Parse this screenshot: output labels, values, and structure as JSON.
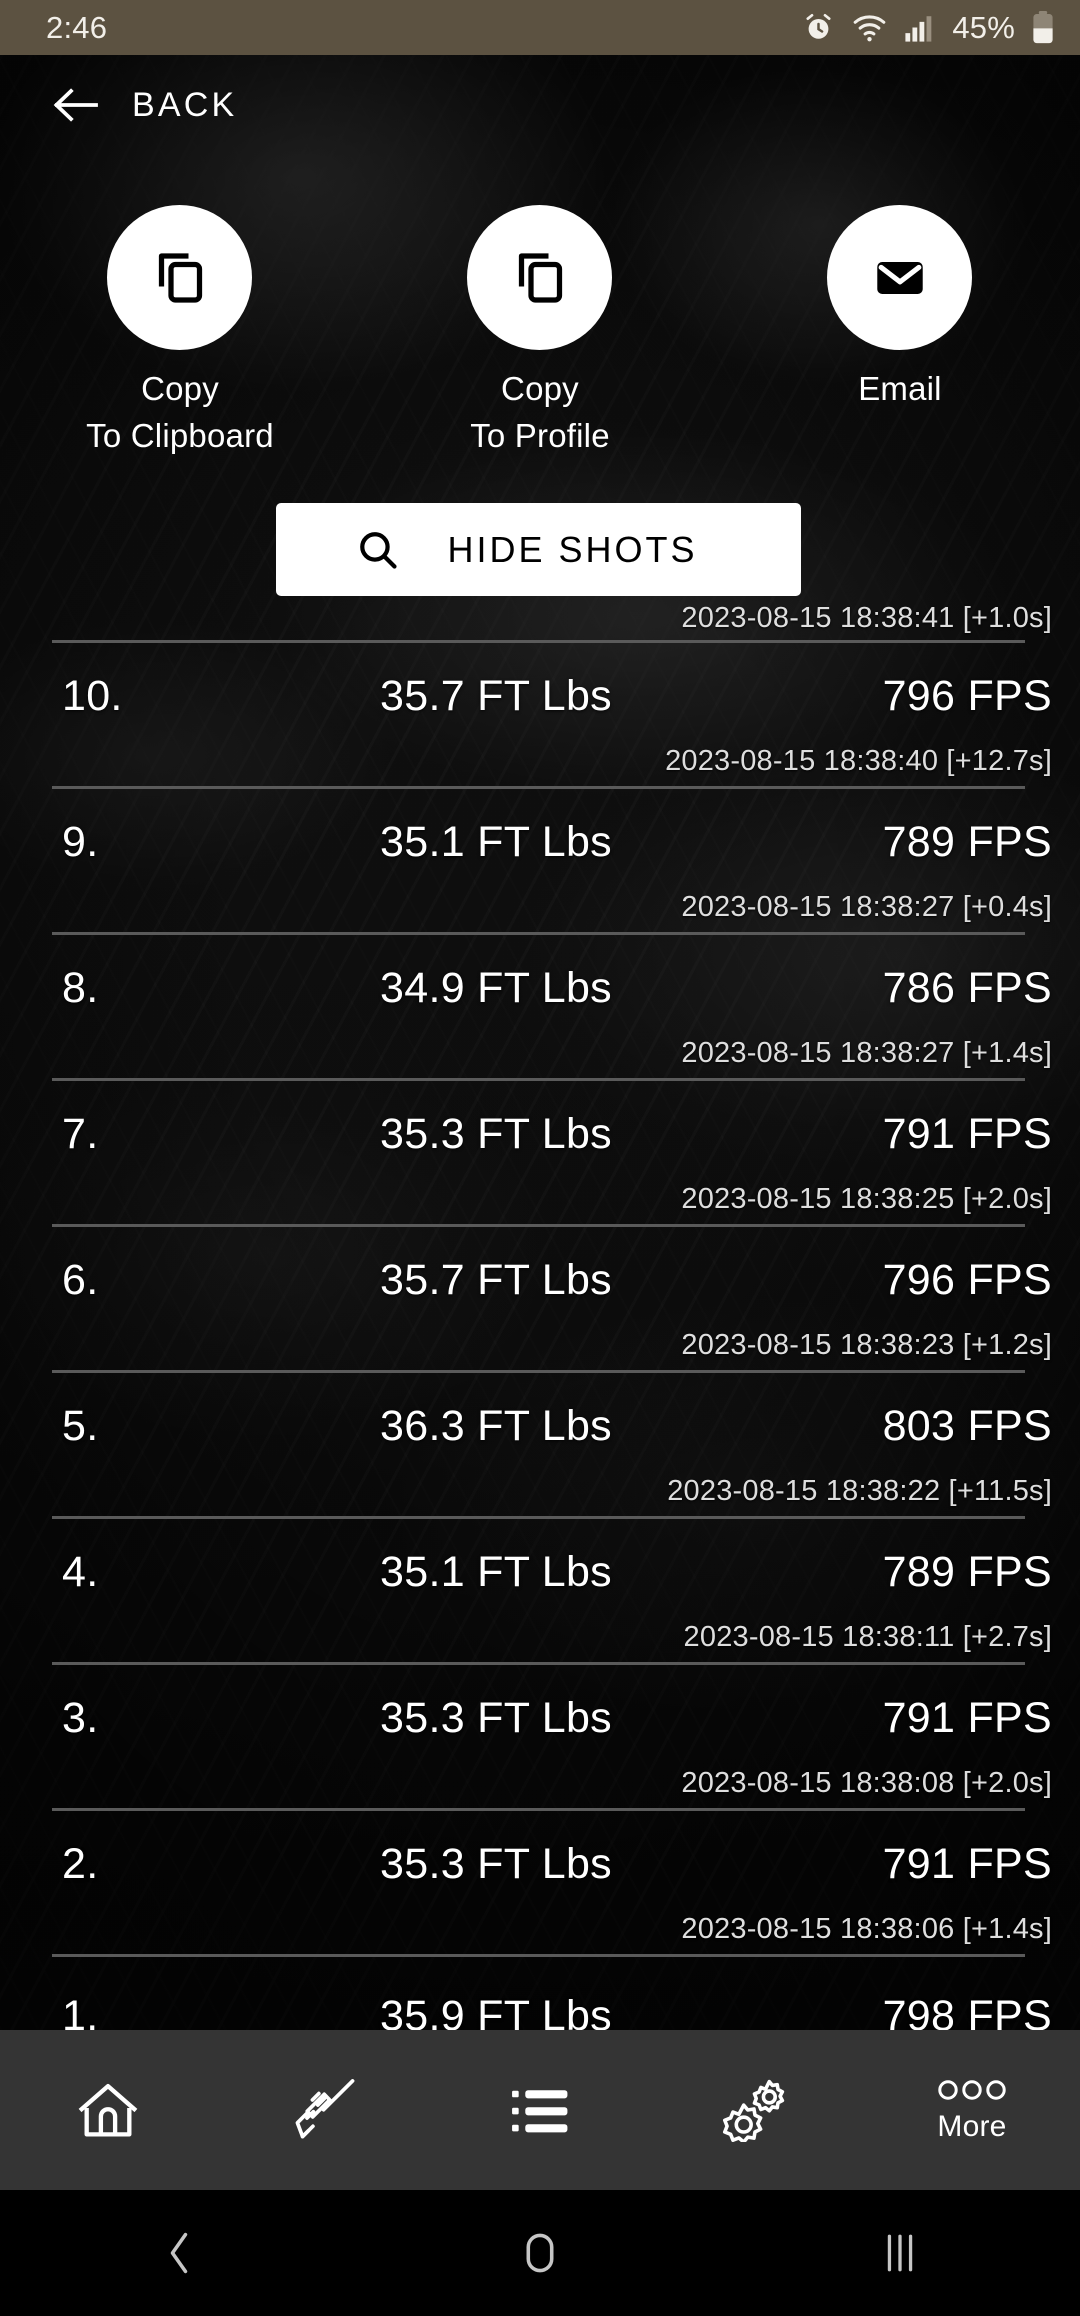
{
  "status_bar": {
    "time": "2:46",
    "battery_percent": "45%",
    "icons": [
      "alarm-clock-icon",
      "wifi-icon",
      "cellular-signal-icon",
      "battery-icon"
    ],
    "background_color": "#5c5241"
  },
  "header": {
    "back_label": "BACK",
    "back_icon": "arrow-left-icon"
  },
  "actions": [
    {
      "label": "Copy\nTo Clipboard",
      "icon": "copy-icon",
      "name": "copy-to-clipboard"
    },
    {
      "label": "Copy\nTo Profile",
      "icon": "copy-icon",
      "name": "copy-to-profile"
    },
    {
      "label": "Email",
      "icon": "envelope-icon",
      "name": "email"
    }
  ],
  "toolbar": {
    "hide_shots_label": "HIDE SHOTS",
    "hide_shots_icon": "search-icon"
  },
  "shot_list": {
    "leading_timestamp": "2023-08-15 18:38:41 [+1.0s]",
    "rows": [
      {
        "index": "10.",
        "energy": "35.7 FT Lbs",
        "speed": "796 FPS",
        "timestamp": "2023-08-15 18:38:40 [+12.7s]"
      },
      {
        "index": "9.",
        "energy": "35.1 FT Lbs",
        "speed": "789 FPS",
        "timestamp": "2023-08-15 18:38:27 [+0.4s]"
      },
      {
        "index": "8.",
        "energy": "34.9 FT Lbs",
        "speed": "786 FPS",
        "timestamp": "2023-08-15 18:38:27 [+1.4s]"
      },
      {
        "index": "7.",
        "energy": "35.3 FT Lbs",
        "speed": "791 FPS",
        "timestamp": "2023-08-15 18:38:25 [+2.0s]"
      },
      {
        "index": "6.",
        "energy": "35.7 FT Lbs",
        "speed": "796 FPS",
        "timestamp": "2023-08-15 18:38:23 [+1.2s]"
      },
      {
        "index": "5.",
        "energy": "36.3 FT Lbs",
        "speed": "803 FPS",
        "timestamp": "2023-08-15 18:38:22 [+11.5s]"
      },
      {
        "index": "4.",
        "energy": "35.1 FT Lbs",
        "speed": "789 FPS",
        "timestamp": "2023-08-15 18:38:11 [+2.7s]"
      },
      {
        "index": "3.",
        "energy": "35.3 FT Lbs",
        "speed": "791 FPS",
        "timestamp": "2023-08-15 18:38:08 [+2.0s]"
      },
      {
        "index": "2.",
        "energy": "35.3 FT Lbs",
        "speed": "791 FPS",
        "timestamp": "2023-08-15 18:38:06 [+1.4s]"
      },
      {
        "index": "1.",
        "energy": "35.9 FT Lbs",
        "speed": "798 FPS",
        "timestamp": ""
      }
    ]
  },
  "bottom_nav": {
    "background_color": "#343434",
    "items": [
      {
        "icon": "home-icon",
        "label": "",
        "name": "nav-home"
      },
      {
        "icon": "rifle-icon",
        "label": "",
        "name": "nav-rifle"
      },
      {
        "icon": "list-icon",
        "label": "",
        "name": "nav-list"
      },
      {
        "icon": "gears-icon",
        "label": "",
        "name": "nav-settings"
      },
      {
        "icon": "three-dots-icon",
        "label": "More",
        "name": "nav-more"
      }
    ]
  },
  "android_nav": {
    "items": [
      {
        "icon": "back-chevron-icon",
        "name": "android-back"
      },
      {
        "icon": "home-circle-icon",
        "name": "android-home"
      },
      {
        "icon": "recents-bars-icon",
        "name": "android-recents"
      }
    ]
  }
}
